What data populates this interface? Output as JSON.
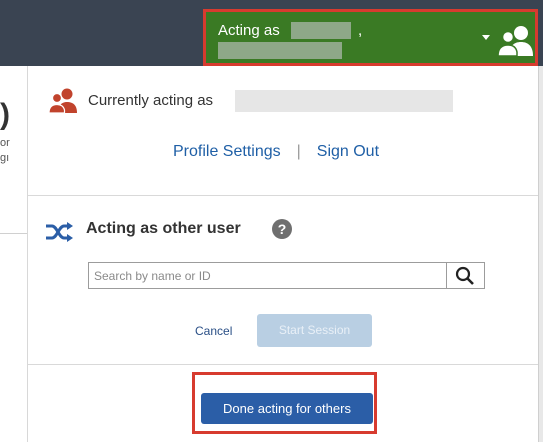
{
  "header": {
    "acting_label": "Acting as",
    "comma": ","
  },
  "menu": {
    "currently_acting_label": "Currently acting as",
    "profile_settings": "Profile Settings",
    "separator": "|",
    "sign_out": "Sign Out",
    "acting_other_title": "Acting as other user",
    "help_glyph": "?",
    "search_placeholder": "Search by name or ID",
    "search_value": "",
    "cancel": "Cancel",
    "start_session": "Start Session",
    "done_acting": "Done acting for others"
  },
  "background": {
    "left_char": ")",
    "left_fragment_1": "or",
    "left_fragment_2": "gı"
  },
  "colors": {
    "header_bg": "#3a4452",
    "acting_bg": "#3a7a24",
    "highlight_border": "#d73b2f",
    "link": "#1f5fa6",
    "primary_button": "#2b5ea7",
    "disabled_button": "#b9cfe3",
    "user_icon_red": "#c1432c"
  },
  "icons": [
    "users-icon",
    "caret-down-icon",
    "shuffle-icon",
    "help-icon",
    "search-icon"
  ]
}
